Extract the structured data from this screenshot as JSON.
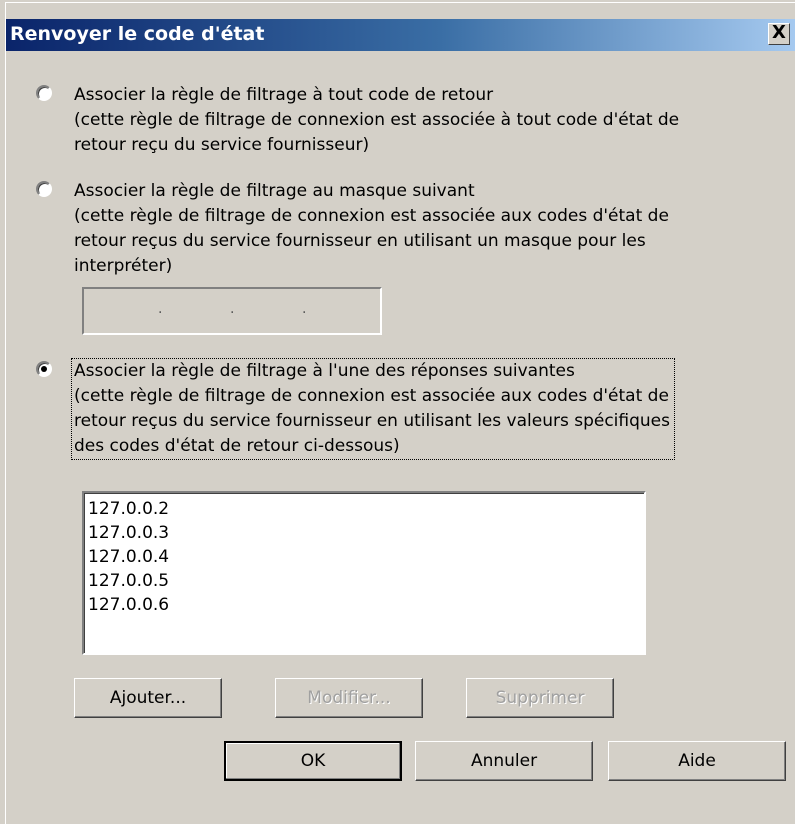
{
  "dialog": {
    "title": "Renvoyer le code d'état",
    "close_label": "X"
  },
  "options": [
    {
      "label": "Associer la règle de filtrage à tout code de retour",
      "desc1": "(cette règle de filtrage de connexion est associée à tout code d'état de",
      "desc2": "retour reçu du service fournisseur)",
      "selected": false
    },
    {
      "label": "Associer la règle de filtrage au masque suivant",
      "desc1": "(cette règle de filtrage de connexion est associée aux codes d'état de",
      "desc2": "retour reçus du service fournisseur en utilisant un masque pour les",
      "desc3": "interpréter)",
      "selected": false
    },
    {
      "label": "Associer la règle de filtrage à l'une des réponses suivantes",
      "desc1": "(cette règle de filtrage de connexion est associée aux codes d'état de",
      "desc2": "retour reçus du service fournisseur en utilisant les valeurs spécifiques",
      "desc3": "des codes d'état de retour ci-dessous)",
      "selected": true
    }
  ],
  "mask_field": {
    "separators": [
      ".",
      ".",
      "."
    ]
  },
  "codes_list": [
    "127.0.0.2",
    "127.0.0.3",
    "127.0.0.4",
    "127.0.0.5",
    "127.0.0.6"
  ],
  "list_buttons": {
    "add": "Ajouter...",
    "edit": "Modifier...",
    "delete": "Supprimer"
  },
  "footer_buttons": {
    "ok": "OK",
    "cancel": "Annuler",
    "help": "Aide"
  }
}
